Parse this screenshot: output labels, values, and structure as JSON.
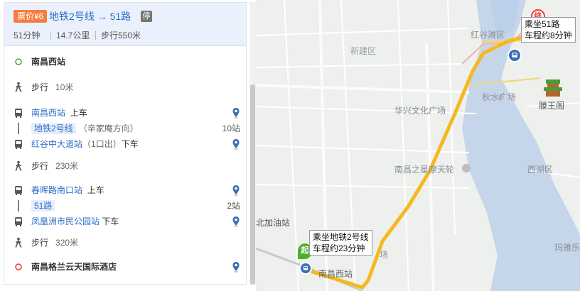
{
  "summary": {
    "fare": "票价¥6",
    "route": "地铁2号线 → 51路",
    "stop_badge": "停",
    "duration": "51分钟",
    "distance": "14.7公里",
    "walk": "步行550米"
  },
  "steps": {
    "origin": "南昌西站",
    "walk1_label": "步行",
    "walk1_dist": "10米",
    "board1_station": "南昌西站",
    "board1_action": "上车",
    "line1_name": "地铁2号线",
    "line1_dir": "（辛家庵方向）",
    "line1_stops": "10站",
    "alight1_station": "红谷中大道站",
    "alight1_exit": "（1口出）",
    "alight1_action": "下车",
    "walk2_label": "步行",
    "walk2_dist": "230米",
    "board2_station": "春晖路南口站",
    "board2_action": "上车",
    "line2_name": "51路",
    "line2_stops": "2站",
    "alight2_station": "凤凰洲市民公园站",
    "alight2_action": "下车",
    "walk3_label": "步行",
    "walk3_dist": "320米",
    "destination": "南昌格兰云天国际酒店"
  },
  "map": {
    "labels": {
      "hongguptan": "红谷滩区",
      "xinjian": "新建区",
      "qiushui": "秋水广场",
      "huaxing": "华兴文化广场",
      "tengwang": "滕王阁",
      "ferris": "南昌之星摩天轮",
      "xihu": "西湖区",
      "jiayou": "北加油站",
      "nanchangxi": "南昌西站",
      "maya": "玛雅乐",
      "chang": "场"
    },
    "bubble_top_l1": "乘坐51路",
    "bubble_top_l2": "车程约8分钟",
    "bubble_bot_l1": "乘坐地铁2号线",
    "bubble_bot_l2": "车程约23分钟",
    "start_marker": "起",
    "end_marker": "终",
    "route_color": "#f5b820",
    "start_color": "#4caf28",
    "end_color": "#e84141"
  }
}
